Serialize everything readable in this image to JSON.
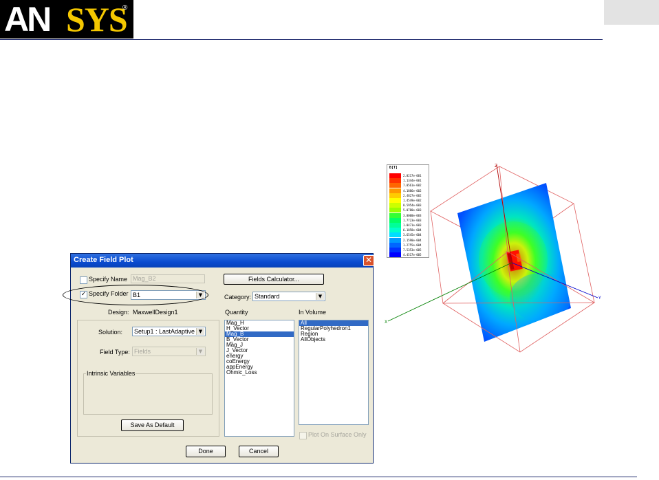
{
  "header": {
    "logo_an": "AN",
    "logo_sys": "SYS",
    "logo_reg": "®"
  },
  "dialog": {
    "title": "Create Field Plot",
    "specify_name": {
      "label": "Specify Name",
      "checked": false,
      "value": "Mag_B2"
    },
    "specify_folder": {
      "label": "Specify Folder",
      "checked": true,
      "value": "B1"
    },
    "fields_calculator_label": "Fields Calculator...",
    "category_label": "Category:",
    "category_value": "Standard",
    "design_label": "Design:",
    "design_value": "MaxwellDesign1",
    "solution_label": "Solution:",
    "solution_value": "Setup1 : LastAdaptive",
    "field_type_label": "Field Type:",
    "field_type_value": "Fields",
    "intrinsic_variables_label": "Intrinsic Variables",
    "save_default_label": "Save As Default",
    "quantity_label": "Quantity",
    "quantity_items": [
      "Mag_H",
      "H_Vector",
      "Mag_B",
      "B_Vector",
      "Mag_J",
      "J_Vector",
      "energy",
      "coEnergy",
      "appEnergy",
      "Ohmic_Loss"
    ],
    "quantity_selected": 2,
    "in_volume_label": "In Volume",
    "in_volume_items": [
      "All",
      "RegularPolyhedron1",
      "Region",
      "AllObjects"
    ],
    "in_volume_selected": 0,
    "plot_on_surface_label": "Plot On Surface Only",
    "done_label": "Done",
    "cancel_label": "Cancel",
    "close_glyph": "✕",
    "check_glyph": "✓",
    "arrow_glyph": "▼"
  },
  "legend": {
    "title": "B[T]",
    "values": [
      "2.0217e-001",
      "1.1344e-001",
      "7.0561e-002",
      "4.1886e-002",
      "2.4827e-002",
      "1.4549e-002",
      "8.5954e-003",
      "5.0780e-003",
      "3.0000e-003",
      "1.7723e-003",
      "1.0471e-003",
      "6.1858e-004",
      "3.6545e-004",
      "2.1590e-004",
      "1.2755e-004",
      "7.5353e-005",
      "4.4517e-005"
    ],
    "colors": [
      "#ff0000",
      "#ff3300",
      "#ff6600",
      "#ff9900",
      "#ffcc00",
      "#ffff00",
      "#ccff00",
      "#99ff00",
      "#33ff33",
      "#00ff66",
      "#00ff99",
      "#00ffcc",
      "#00ddff",
      "#0099ff",
      "#0066ff",
      "#0033ff",
      "#0000ff"
    ]
  },
  "model": {
    "axis_z": "Z",
    "axis_y": "Y",
    "axis_x": "X",
    "colors": {
      "box_edges": "#e06060",
      "axis_z": "#b00000",
      "axis_y": "#0000cc",
      "axis_x": "#008000"
    }
  }
}
